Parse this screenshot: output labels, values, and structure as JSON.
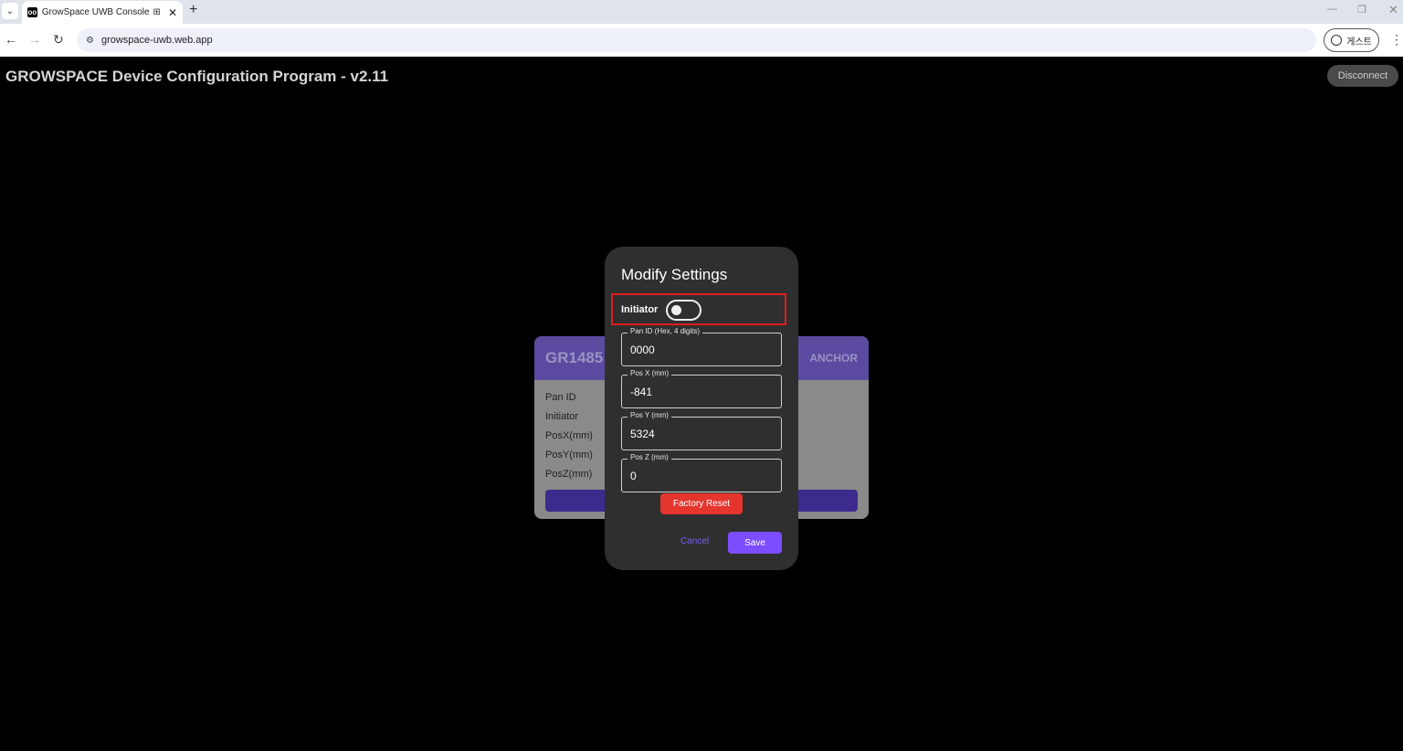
{
  "browser": {
    "tab_title": "GrowSpace UWB Console",
    "favicon_text": "oo",
    "url": "growspace-uwb.web.app",
    "profile_label": "게스트"
  },
  "app": {
    "title": "GROWSPACE Device Configuration Program - v2.11",
    "disconnect_label": "Disconnect"
  },
  "card": {
    "name": "GR1485",
    "type": "ANCHOR",
    "rows": [
      "Pan ID",
      "Initiator",
      "PosX(mm)",
      "PosY(mm)",
      "PosZ(mm)"
    ]
  },
  "modal": {
    "title": "Modify Settings",
    "initiator_label": "Initiator",
    "initiator_on": false,
    "fields": [
      {
        "label": "Pan ID (Hex, 4 digits)",
        "value": "0000"
      },
      {
        "label": "Pos X (mm)",
        "value": "-841"
      },
      {
        "label": "Pos Y (mm)",
        "value": "5324"
      },
      {
        "label": "Pos Z (mm)",
        "value": "0"
      }
    ],
    "factory_reset_label": "Factory Reset",
    "cancel_label": "Cancel",
    "save_label": "Save"
  },
  "colors": {
    "accent": "#7c4dff",
    "danger": "#e5362e",
    "highlight": "#e01e1e",
    "card_header": "#5b4aa0"
  }
}
